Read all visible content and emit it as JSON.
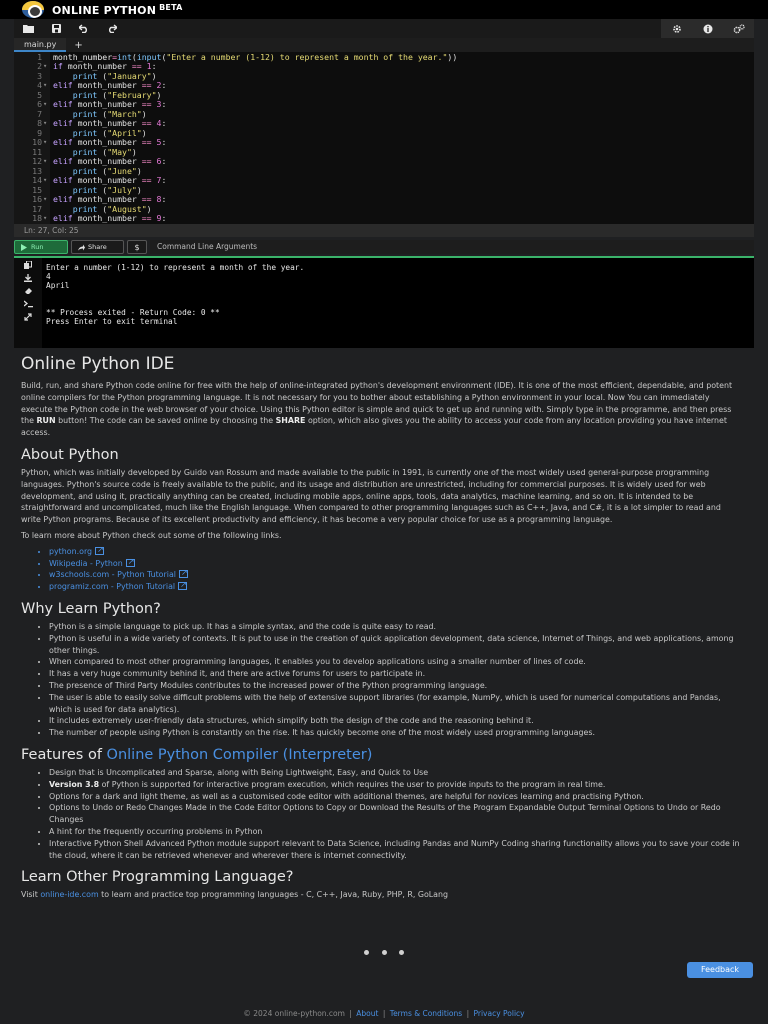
{
  "app": {
    "brand": "ONLINE PYTHON",
    "beta": "BETA"
  },
  "toolbar": {
    "left": [
      "folder-open-icon",
      "save-icon",
      "undo-icon",
      "redo-icon"
    ],
    "right": [
      "theme-settings-icon",
      "info-icon",
      "settings-icon"
    ]
  },
  "tabs": {
    "file": "main.py",
    "add": "+"
  },
  "editor": {
    "lines": [
      {
        "n": "1",
        "fold": "",
        "html": "<span class='var'>month_number</span><span class='op'>=</span><span class='fn'>int</span>(<span class='fn'>input</span>(<span class='str'>\"Enter a number (1-12) to represent a month of the year.\"</span>))"
      },
      {
        "n": "2",
        "fold": "▾",
        "html": "<span class='kw'>if</span> month_number <span class='op'>==</span> <span class='num'>1</span>:"
      },
      {
        "n": "3",
        "fold": "",
        "html": "    <span class='fn'>print</span> (<span class='str'>\"January\"</span>)"
      },
      {
        "n": "4",
        "fold": "▾",
        "html": "<span class='kw'>elif</span> month_number <span class='op'>==</span> <span class='num'>2</span>:"
      },
      {
        "n": "5",
        "fold": "",
        "html": "    <span class='fn'>print</span> (<span class='str'>\"February\"</span>)"
      },
      {
        "n": "6",
        "fold": "▾",
        "html": "<span class='kw'>elif</span> month_number <span class='op'>==</span> <span class='num'>3</span>:"
      },
      {
        "n": "7",
        "fold": "",
        "html": "    <span class='fn'>print</span> (<span class='str'>\"March\"</span>)"
      },
      {
        "n": "8",
        "fold": "▾",
        "html": "<span class='kw'>elif</span> month_number <span class='op'>==</span> <span class='num'>4</span>:"
      },
      {
        "n": "9",
        "fold": "",
        "html": "    <span class='fn'>print</span> (<span class='str'>\"April\"</span>)"
      },
      {
        "n": "10",
        "fold": "▾",
        "html": "<span class='kw'>elif</span> month_number <span class='op'>==</span> <span class='num'>5</span>:"
      },
      {
        "n": "11",
        "fold": "",
        "html": "    <span class='fn'>print</span> (<span class='str'>\"May\"</span>)"
      },
      {
        "n": "12",
        "fold": "▾",
        "html": "<span class='kw'>elif</span> month_number <span class='op'>==</span> <span class='num'>6</span>:"
      },
      {
        "n": "13",
        "fold": "",
        "html": "    <span class='fn'>print</span> (<span class='str'>\"June\"</span>)"
      },
      {
        "n": "14",
        "fold": "▾",
        "html": "<span class='kw'>elif</span> month_number <span class='op'>==</span> <span class='num'>7</span>:"
      },
      {
        "n": "15",
        "fold": "",
        "html": "    <span class='fn'>print</span> (<span class='str'>\"July\"</span>)"
      },
      {
        "n": "16",
        "fold": "▾",
        "html": "<span class='kw'>elif</span> month_number <span class='op'>==</span> <span class='num'>8</span>:"
      },
      {
        "n": "17",
        "fold": "",
        "html": "    <span class='fn'>print</span> (<span class='str'>\"August\"</span>)"
      },
      {
        "n": "18",
        "fold": "▾",
        "html": "<span class='kw'>elif</span> month_number <span class='op'>==</span> <span class='num'>9</span>:"
      }
    ],
    "status": "Ln: 27,  Col: 25"
  },
  "runbar": {
    "run": "Run",
    "share": "Share",
    "dollar": "$",
    "args": "Command Line Arguments"
  },
  "terminal": {
    "icons": [
      "copy-icon",
      "download-icon",
      "erase-icon",
      "prompt-icon",
      "expand-icon"
    ],
    "output": "Enter a number (1-12) to represent a month of the year.\n4\nApril\n\n\n** Process exited - Return Code: 0 **\nPress Enter to exit terminal"
  },
  "content": {
    "h_ide": "Online Python IDE",
    "p_ide": "Build, run, and share Python code online for free with the help of online-integrated python's development environment (IDE). It is one of the most efficient, dependable, and potent online compilers for the Python programming language. It is not necessary for you to bother about establishing a Python environment in your local. Now You can immediately execute the Python code in the web browser of your choice. Using this Python editor is simple and quick to get up and running with. Simply type in the programme, and then press the <b>RUN</b> button! The code can be saved online by choosing the <b>SHARE</b> option, which also gives you the ability to access your code from any location providing you have internet access.",
    "h_about": "About Python",
    "p_about": "Python, which was initially developed by Guido van Rossum and made available to the public in 1991, is currently one of the most widely used general-purpose programming languages. Python's source code is freely available to the public, and its usage and distribution are unrestricted, including for commercial purposes. It is widely used for web development, and using it, practically anything can be created, including mobile apps, online apps, tools, data analytics, machine learning, and so on. It is intended to be straightforward and uncomplicated, much like the English language. When compared to other programming languages such as C++, Java, and C#, it is a lot simpler to read and write Python programs. Because of its excellent productivity and efficiency, it has become a very popular choice for use as a programming language.",
    "p_links": "To learn more about Python check out some of the following links.",
    "links": [
      "python.org",
      "Wikipedia - Python",
      "w3schools.com - Python Tutorial",
      "programiz.com - Python Tutorial"
    ],
    "h_why": "Why Learn Python?",
    "why": [
      "Python is a simple language to pick up. It has a simple syntax, and the code is quite easy to read.",
      "Python is useful in a wide variety of contexts. It is put to use in the creation of quick application development, data science, Internet of Things, and web applications, among other things.",
      "When compared to most other programming languages, it enables you to develop applications using a smaller number of lines of code.",
      "It has a very huge community behind it, and there are active forums for users to participate in.",
      "The presence of Third Party Modules contributes to the increased power of the Python programming language.",
      "The user is able to easily solve difficult problems with the help of extensive support libraries (for example, NumPy, which is used for numerical computations and Pandas, which is used for data analytics).",
      "It includes extremely user-friendly data structures, which simplify both the design of the code and the reasoning behind it.",
      "The number of people using Python is constantly on the rise. It has quickly become one of the most widely used programming languages."
    ],
    "h_features_pre": "Features of ",
    "h_features_link": "Online Python Compiler (Interpreter)",
    "features": [
      "Design that is Uncomplicated and Sparse, along with Being Lightweight, Easy, and Quick to Use",
      "<b>Version 3.8</b> of Python is supported for interactive program execution, which requires the user to provide inputs to the program in real time.",
      "Options for a dark and light theme, as well as a customised code editor with additional themes, are helpful for novices learning and practising Python.",
      "Options to Undo or Redo Changes Made in the Code Editor Options to Copy or Download the Results of the Program Expandable Output Terminal Options to Undo or Redo Changes",
      "A hint for the frequently occurring problems in Python",
      "Interactive Python Shell Advanced Python module support relevant to Data Science, including Pandas and NumPy Coding sharing functionality allows you to save your code in the cloud, where it can be retrieved whenever and wherever there is internet connectivity."
    ],
    "h_other": "Learn Other Programming Language?",
    "p_other_pre": "Visit ",
    "p_other_link": "online-ide.com",
    "p_other_post": " to learn and practice top programming languages - C, C++, Java, Ruby, PHP, R, GoLang"
  },
  "feedback": "Feedback",
  "footer": {
    "copyright": "© 2024 online-python.com",
    "about": "About",
    "terms": "Terms & Conditions",
    "privacy": "Privacy Policy"
  }
}
